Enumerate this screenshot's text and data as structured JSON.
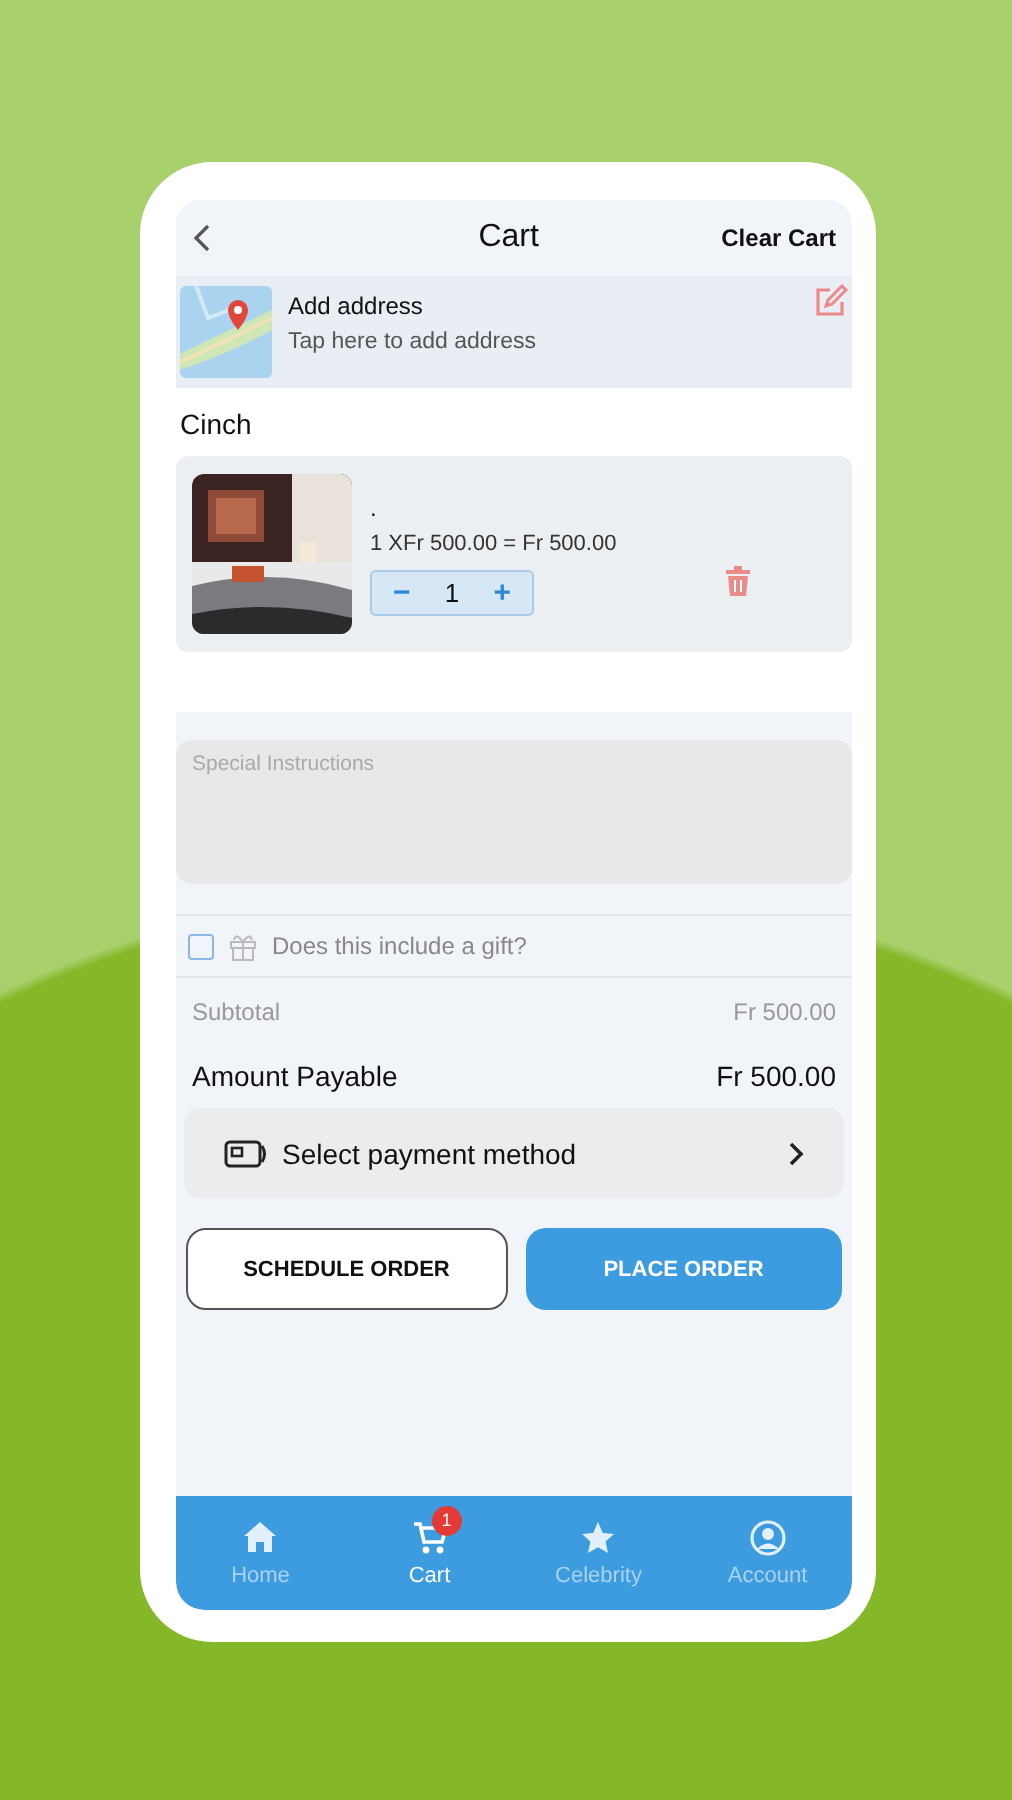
{
  "header": {
    "title": "Cart",
    "action": "Clear Cart"
  },
  "address": {
    "title": "Add address",
    "subtitle": "Tap here to add address"
  },
  "store": "Cinch",
  "items": [
    {
      "name": ".",
      "price_line": "1 XFr 500.00 = Fr 500.00",
      "quantity": "1",
      "minus": "−",
      "plus": "+"
    }
  ],
  "instructions": {
    "placeholder": "Special Instructions"
  },
  "gift": {
    "label": "Does this include a gift?",
    "checked": false
  },
  "subtotal": {
    "label": "Subtotal",
    "value": "Fr 500.00"
  },
  "total": {
    "label": "Amount Payable",
    "value": "Fr 500.00"
  },
  "payment": {
    "label": "Select payment method"
  },
  "buttons": [
    {
      "kind": "outline",
      "label": "SCHEDULE ORDER"
    },
    {
      "kind": "primary",
      "label": "PLACE ORDER"
    }
  ],
  "nav": [
    {
      "kind": "home",
      "label": "Home",
      "selected": false
    },
    {
      "kind": "cart",
      "label": "Cart",
      "selected": true,
      "badge": "1"
    },
    {
      "kind": "star",
      "label": "Celebrity",
      "selected": false
    },
    {
      "kind": "account",
      "label": "Account",
      "selected": false
    }
  ]
}
